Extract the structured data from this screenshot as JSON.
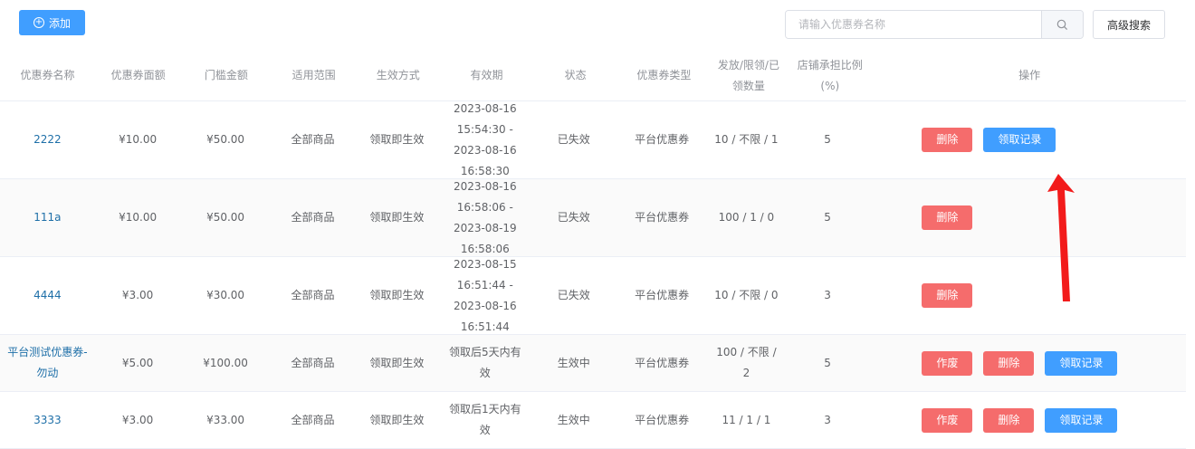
{
  "toolbar": {
    "add_label": "添加",
    "search_placeholder": "请输入优惠券名称",
    "advanced_search_label": "高级搜索"
  },
  "table": {
    "columns": [
      "优惠券名称",
      "优惠券面额",
      "门槛金额",
      "适用范围",
      "生效方式",
      "有效期",
      "状态",
      "优惠券类型",
      "发放/限领/已领数量",
      "店铺承担比例(%)",
      "操作"
    ],
    "rows": [
      {
        "name": "2222",
        "face": "¥10.00",
        "threshold": "¥50.00",
        "scope": "全部商品",
        "effect": "领取即生效",
        "validity": "2023-08-16 15:54:30 - 2023-08-16 16:58:30",
        "status": "已失效",
        "type": "平台优惠券",
        "qty": "10 / 不限 / 1",
        "ratio": "5",
        "actions": [
          "删除",
          "领取记录"
        ]
      },
      {
        "name": "111a",
        "face": "¥10.00",
        "threshold": "¥50.00",
        "scope": "全部商品",
        "effect": "领取即生效",
        "validity": "2023-08-16 16:58:06 - 2023-08-19 16:58:06",
        "status": "已失效",
        "type": "平台优惠券",
        "qty": "100 / 1 / 0",
        "ratio": "5",
        "actions": [
          "删除"
        ]
      },
      {
        "name": "4444",
        "face": "¥3.00",
        "threshold": "¥30.00",
        "scope": "全部商品",
        "effect": "领取即生效",
        "validity": "2023-08-15 16:51:44 - 2023-08-16 16:51:44",
        "status": "已失效",
        "type": "平台优惠券",
        "qty": "10 / 不限 / 0",
        "ratio": "3",
        "actions": [
          "删除"
        ]
      },
      {
        "name": "平台测试优惠券-勿动",
        "face": "¥5.00",
        "threshold": "¥100.00",
        "scope": "全部商品",
        "effect": "领取即生效",
        "validity": "领取后5天内有效",
        "status": "生效中",
        "type": "平台优惠券",
        "qty": "100 / 不限 / 2",
        "ratio": "5",
        "actions": [
          "作废",
          "删除",
          "领取记录"
        ]
      },
      {
        "name": "3333",
        "face": "¥3.00",
        "threshold": "¥33.00",
        "scope": "全部商品",
        "effect": "领取即生效",
        "validity": "领取后1天内有效",
        "status": "生效中",
        "type": "平台优惠券",
        "qty": "11 / 1 / 1",
        "ratio": "3",
        "actions": [
          "作废",
          "删除",
          "领取记录"
        ]
      }
    ]
  },
  "colors": {
    "primary": "#409eff",
    "danger": "#f56c6c",
    "link": "#1e6fa8",
    "annotation": "#f21b1b"
  }
}
